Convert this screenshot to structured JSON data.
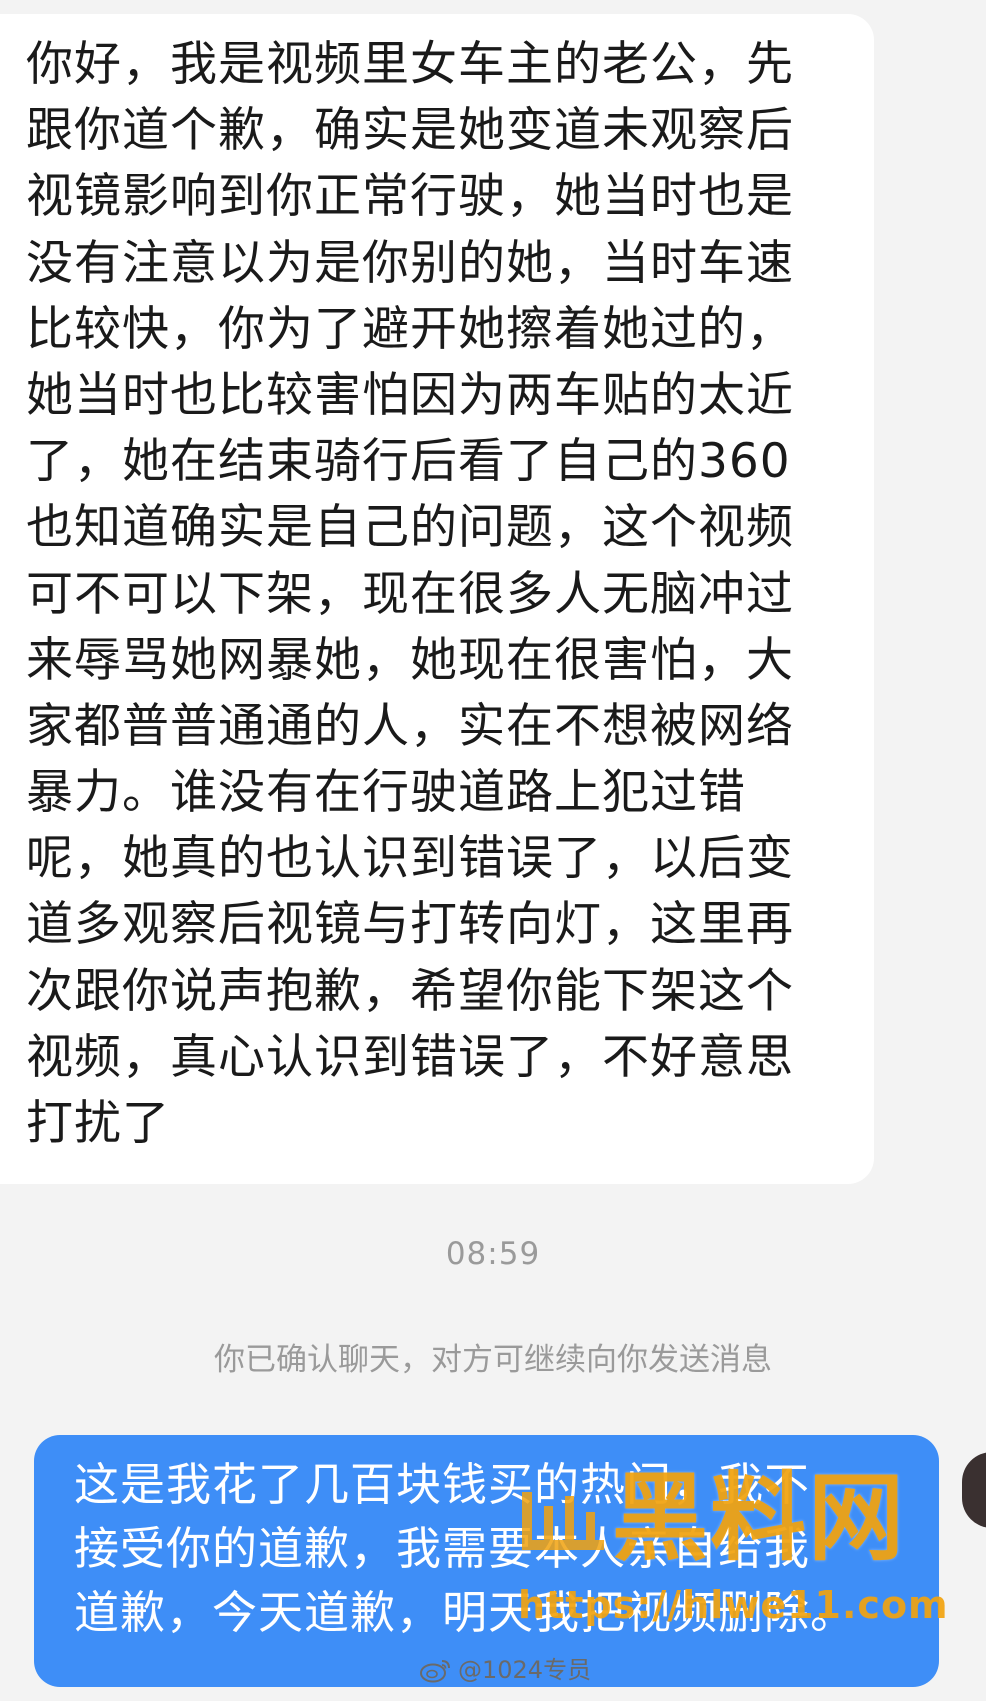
{
  "incoming_message": {
    "lines": [
      "你好，我是视频里女车主的老公，先",
      "跟你道个歉，确实是她变道未观察后",
      "视镜影响到你正常行驶，她当时也是",
      "没有注意以为是你别的她，当时车速",
      "比较快，你为了避开她擦着她过的，",
      "她当时也比较害怕因为两车贴的太近",
      "了，她在结束骑行后看了自己的360",
      "也知道确实是自己的问题，这个视频",
      "可不可以下架，现在很多人无脑冲过",
      "来辱骂她网暴她，她现在很害怕，大",
      "家都普普通通的人，实在不想被网络",
      "暴力。谁没有在行驶道路上犯过错",
      "呢，她真的也认识到错误了，以后变",
      "道多观察后视镜与打转向灯，这里再",
      "次跟你说声抱歉，希望你能下架这个",
      "视频，真心认识到错误了，不好意思",
      "打扰了"
    ]
  },
  "timestamp": "08:59",
  "system_notice": "你已确认聊天，对方可继续向你发送消息",
  "outgoing_message": {
    "lines": [
      "这是我花了几百块钱买的热门，我不",
      "接受你的道歉，我需要本人亲自给我",
      "道歉，今天道歉，明天我把视频删除。"
    ]
  },
  "watermark": {
    "brand": "黑料网",
    "url": "https://hlwe11.com"
  },
  "weibo_credit": "@1024专员",
  "colors": {
    "background": "#f3f3f3",
    "incoming_bubble": "#ffffff",
    "outgoing_bubble": "#3e8ef7",
    "watermark": "#f2a30f"
  }
}
